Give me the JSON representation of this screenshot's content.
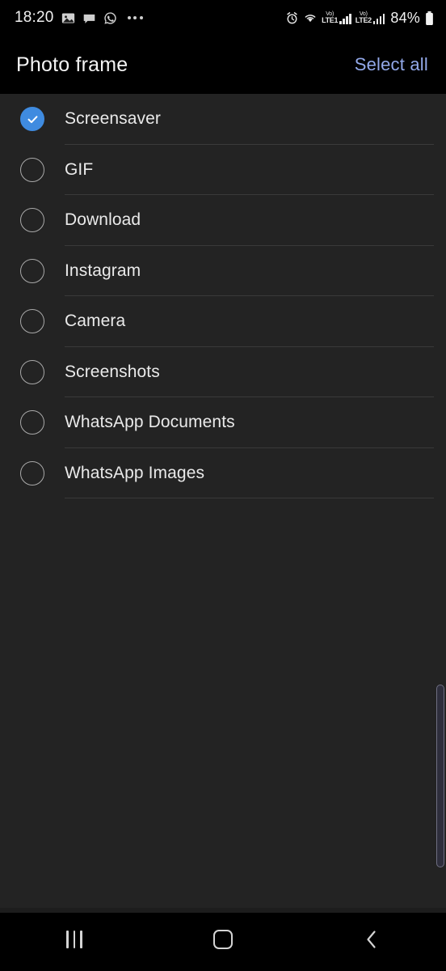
{
  "status_bar": {
    "time": "18:20",
    "left_icons": [
      "gallery-icon",
      "message-icon",
      "whatsapp-icon",
      "overflow-dots-icon"
    ],
    "right_icons": [
      "alarm-icon",
      "wifi-icon"
    ],
    "sim1": {
      "volte": "Vo)",
      "network": "LTE1"
    },
    "sim2": {
      "volte": "Vo)",
      "network": "LTE2"
    },
    "battery_percent": "84%",
    "battery_icon": "battery-full-icon"
  },
  "header": {
    "title": "Photo frame",
    "select_all_label": "Select all",
    "select_all_color": "#93a9ea"
  },
  "list": {
    "accent_color": "#3f8be0",
    "items": [
      {
        "label": "Screensaver",
        "checked": true
      },
      {
        "label": "GIF",
        "checked": false
      },
      {
        "label": "Download",
        "checked": false
      },
      {
        "label": "Instagram",
        "checked": false
      },
      {
        "label": "Camera",
        "checked": false
      },
      {
        "label": "Screenshots",
        "checked": false
      },
      {
        "label": "WhatsApp Documents",
        "checked": false
      },
      {
        "label": "WhatsApp Images",
        "checked": false
      }
    ]
  },
  "nav_bar": {
    "recents_label": "Recents",
    "home_label": "Home",
    "back_label": "Back"
  },
  "colors": {
    "background": "#232323",
    "header_background": "#000000",
    "divider": "#3a3a3a",
    "text": "#eaeaea"
  }
}
